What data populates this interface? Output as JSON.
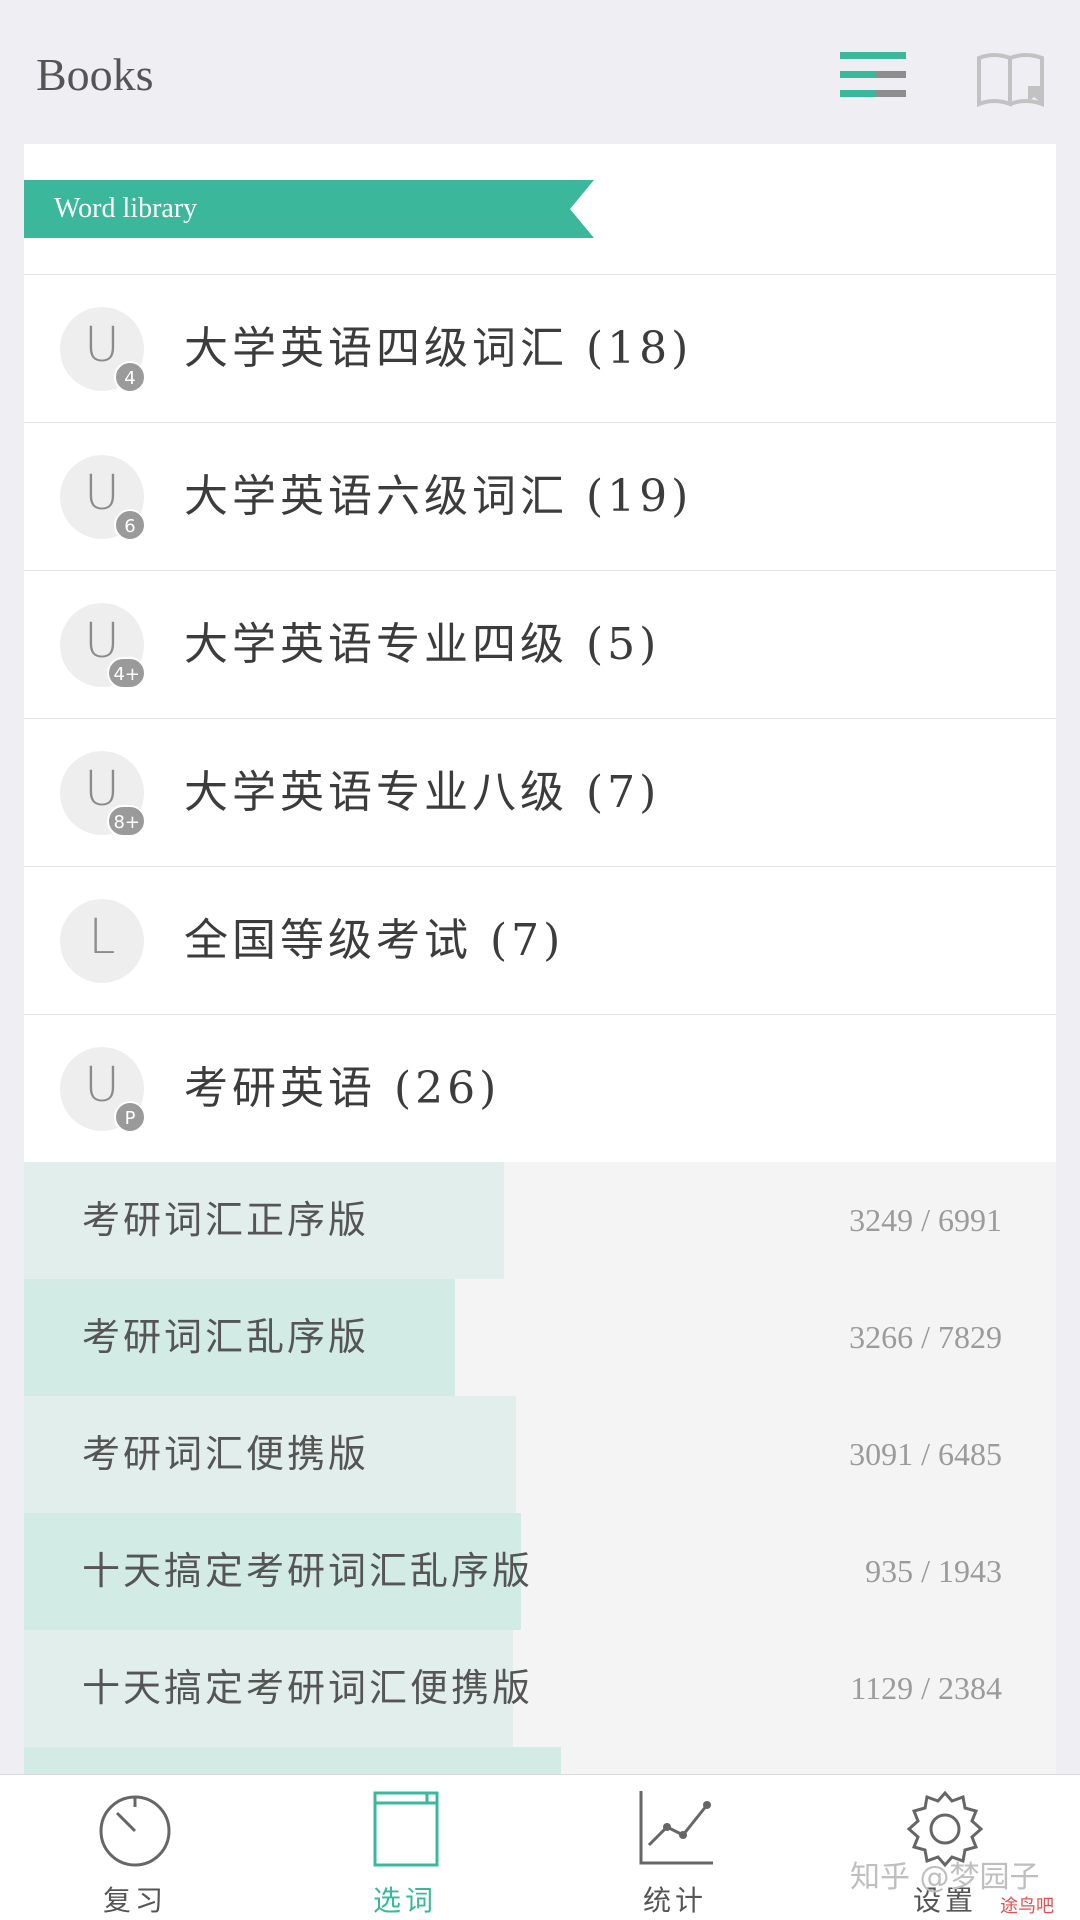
{
  "header": {
    "title": "Books",
    "menu_icon": "menu-icon",
    "book_icon": "book-icon"
  },
  "colors": {
    "accent": "#3bb89c",
    "bar_light": "#e2eeeb",
    "bar_dark": "#d2ebe5"
  },
  "library": {
    "ribbon_label": "Word library",
    "categories": [
      {
        "letter": "U",
        "badge": "4",
        "label": "大学英语四级词汇 (18)"
      },
      {
        "letter": "U",
        "badge": "6",
        "label": "大学英语六级词汇 (19)"
      },
      {
        "letter": "U",
        "badge": "4+",
        "label": "大学英语专业四级 (5)"
      },
      {
        "letter": "U",
        "badge": "8+",
        "label": "大学英语专业八级 (7)"
      },
      {
        "letter": "L",
        "badge": "",
        "label": "全国等级考试 (7)"
      },
      {
        "letter": "U",
        "badge": "P",
        "label": "考研英语 (26)"
      }
    ],
    "subitems": [
      {
        "label": "考研词汇正序版",
        "count": "3249 / 6991",
        "progress": 0.4647
      },
      {
        "label": "考研词汇乱序版",
        "count": "3266 / 7829",
        "progress": 0.4172
      },
      {
        "label": "考研词汇便携版",
        "count": "3091 / 6485",
        "progress": 0.4766
      },
      {
        "label": "十天搞定考研词汇乱序版",
        "count": "935 / 1943",
        "progress": 0.4812
      },
      {
        "label": "十天搞定考研词汇便携版",
        "count": "1129 / 2384",
        "progress": 0.4736
      },
      {
        "label": "",
        "count": "",
        "progress": 0.52
      }
    ]
  },
  "tabbar": {
    "tabs": [
      {
        "label": "复习",
        "icon": "timer-icon"
      },
      {
        "label": "选词",
        "icon": "book-cover-icon",
        "active": true
      },
      {
        "label": "统计",
        "icon": "line-chart-icon"
      },
      {
        "label": "设置",
        "icon": "gear-icon"
      }
    ]
  },
  "watermark": {
    "text": "知乎 @梦园子",
    "site": "途鸟吧"
  }
}
